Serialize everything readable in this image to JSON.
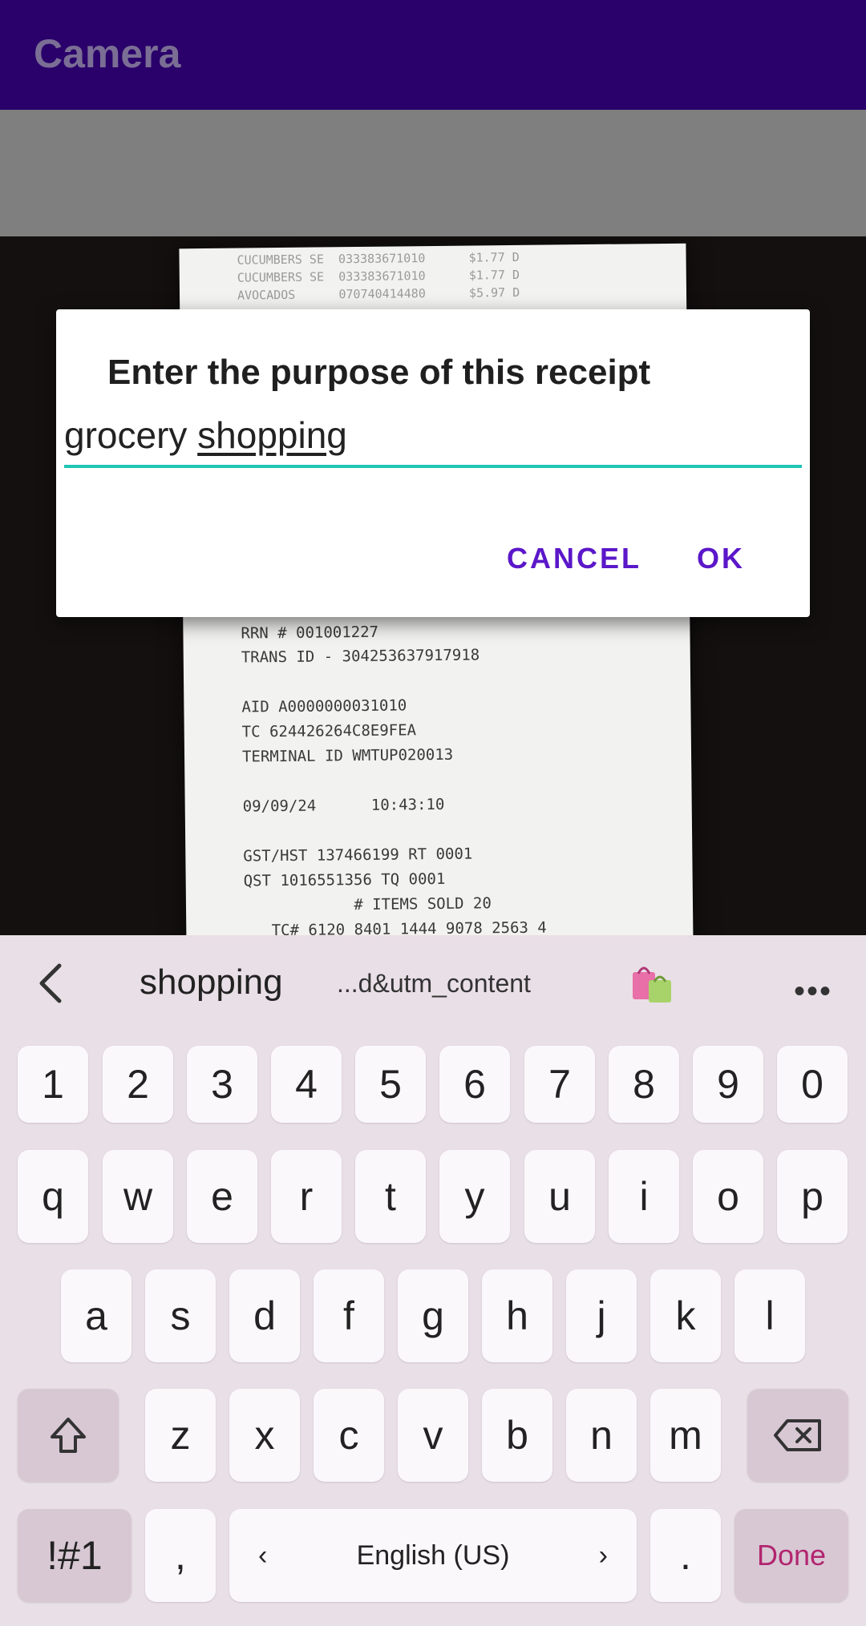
{
  "app_bar": {
    "title": "Camera"
  },
  "receipt_lines": [
    "CUCUMBERS SE  033383671010      $1.77 D",
    "CUCUMBERS SE  033383671010      $1.77 D",
    "AVOCADOS      070740414480      $5.97 D",
    "RRN # 001001227",
    "TRANS ID - 304253637917918",
    "AID A0000000031010",
    "TC 624426264C8E9FEA",
    "TERMINAL ID WMTUP020013",
    "09/09/24      10:43:10",
    "GST/HST 137466199 RT 0001",
    "QST 1016551356 TQ 0001",
    "            # ITEMS SOLD 20",
    "   TC# 6120 8401 1444 9078 2563 4"
  ],
  "dialog": {
    "title": "Enter the purpose of this receipt",
    "input_word1": "grocery",
    "input_word2": "shopping",
    "cancel_label": "CANCEL",
    "ok_label": "OK"
  },
  "keyboard": {
    "suggestion_word": "shopping",
    "suggestion_url": "...d&utm_content",
    "more_label": "•••",
    "row_numbers": [
      "1",
      "2",
      "3",
      "4",
      "5",
      "6",
      "7",
      "8",
      "9",
      "0"
    ],
    "row1": [
      "q",
      "w",
      "e",
      "r",
      "t",
      "y",
      "u",
      "i",
      "o",
      "p"
    ],
    "row2": [
      "a",
      "s",
      "d",
      "f",
      "g",
      "h",
      "j",
      "k",
      "l"
    ],
    "row3": [
      "z",
      "x",
      "c",
      "v",
      "b",
      "n",
      "m"
    ],
    "symbols_label": "!#1",
    "comma_label": ",",
    "space_label": "English (US)",
    "period_label": ".",
    "done_label": "Done",
    "accent_color": "#b2256f"
  },
  "colors": {
    "app_bar": "#2a006b",
    "dialog_button": "#5b17c9",
    "input_underline": "#1fc5b5",
    "keyboard_bg": "#e9dfe6"
  }
}
